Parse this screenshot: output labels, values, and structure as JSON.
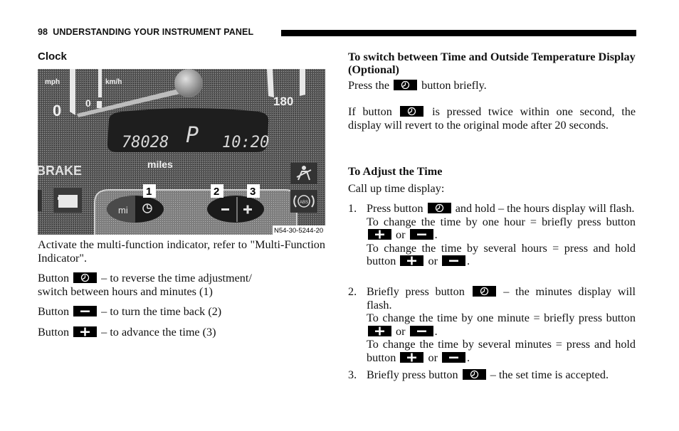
{
  "header": {
    "page_number": "98",
    "section": "UNDERSTANDING YOUR INSTRUMENT PANEL",
    "full": "98  UNDERSTANDING YOUR INSTRUMENT PANEL"
  },
  "left": {
    "title": "Clock",
    "figure": {
      "speed_unit_primary": "mph",
      "speed_unit_secondary": "km/h",
      "speed_zero": "0",
      "speed_zero_secondary": "0",
      "speed_max": "180",
      "odometer": "78028",
      "gear": "P",
      "clock": "10:20",
      "odometer_unit": "miles",
      "warning_label": "BRAKE",
      "button_mi_label": "mi",
      "callouts": [
        "1",
        "2",
        "3"
      ],
      "abs_label": "ABS",
      "figure_id": "N54-30-5244-20"
    },
    "intro": "Activate the multi-function indicator, refer to \"Multi-Function Indicator\".",
    "buttons": [
      {
        "prefix": "Button",
        "icon": "clock-icon",
        "text": " – to reverse the time adjustment/",
        "text2": "switch between hours and minutes (1)"
      },
      {
        "prefix": "Button",
        "icon": "minus-icon",
        "text": " – to turn the time back (2)"
      },
      {
        "prefix": "Button",
        "icon": "plus-icon",
        "text": " – to advance the time (3)"
      }
    ]
  },
  "right": {
    "switch_title": "To switch between Time and Outside Temperature Display (Optional)",
    "switch_p1_a": "Press the",
    "switch_p1_b": "button briefly.",
    "switch_p2_a": "If button",
    "switch_p2_b": "is pressed twice within one second, the display will revert to the original mode after 20 seconds.",
    "adjust_title": "To Adjust the Time",
    "adjust_intro": "Call up time display:",
    "steps": [
      {
        "num": "1.",
        "a": "Press button",
        "b": "and hold – the hours display will flash.",
        "c": "To change the time by one hour = briefly press button",
        "or": "or",
        "d": "To change the time by several hours = press and hold button"
      },
      {
        "num": "2.",
        "a": "Briefly press button",
        "b": "– the minutes display will flash.",
        "c": "To change the time by one minute = briefly press button",
        "or": "or",
        "d": "To change the time by several minutes = press and hold button"
      },
      {
        "num": "3.",
        "a": "Briefly press button",
        "b": "– the set time is accepted."
      }
    ]
  }
}
